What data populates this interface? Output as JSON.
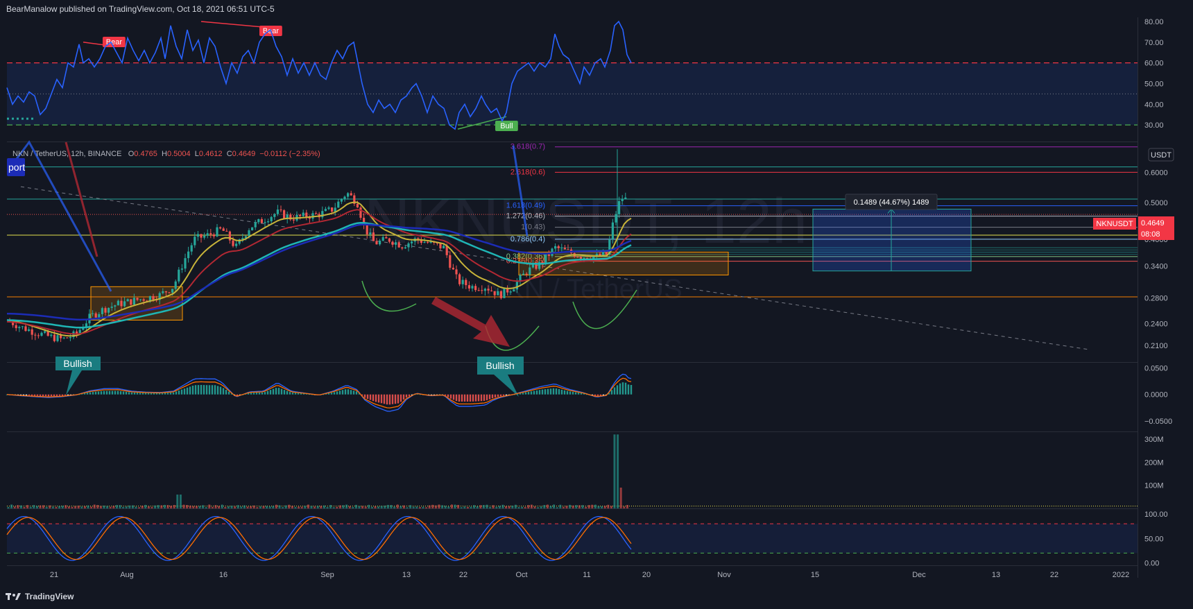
{
  "header": {
    "author": "BearManalow",
    "text": "BearManalow published on TradingView.com, Oct 18, 2021 06:51 UTC-5"
  },
  "footer": {
    "brand": "TradingView"
  },
  "symbol_line": {
    "name": "NKN / TetherUS, 12h, BINANCE",
    "open_label": "O",
    "open": "0.4765",
    "high_label": "H",
    "high": "0.5004",
    "low_label": "L",
    "low": "0.4612",
    "close_label": "C",
    "close": "0.4649",
    "change": "−0.0112 (−2.35%)"
  },
  "watermark": {
    "main": "NKNUSDT, 12h",
    "sub": "NKN / TetherUS"
  },
  "currency_badge": "USDT",
  "price_tag": {
    "symbol": "NKNUSDT",
    "price": "0.4649",
    "countdown": "08:08"
  },
  "measure_label": "0.1489 (44.67%) 1489",
  "labels": {
    "bear1": "Bear",
    "bear2": "Bear",
    "bull": "Bull",
    "bullish1": "Bullish",
    "bullish2": "Bullish",
    "support": "port"
  },
  "colors": {
    "background": "#131722",
    "rsi_line": "#2962ff",
    "bull": "#26a69a",
    "bear": "#ef5350",
    "ema_yellow": "#c8b43a",
    "ema_red": "#b22833",
    "ema_teal": "#1fb5b5",
    "ema_blue": "#1c2cb7"
  },
  "chart_data": {
    "type": "candlestick-multi-panel",
    "x_ticks": [
      "21",
      "Aug",
      "16",
      "Sep",
      "13",
      "22",
      "Oct",
      "11",
      "20",
      "Nov",
      "15",
      "Dec",
      "13",
      "22",
      "2022"
    ],
    "price_panel": {
      "ylim": [
        0.19,
        0.72
      ],
      "y_ticks": [
        "0.2100",
        "0.2400",
        "0.2800",
        "0.3400",
        "0.4000",
        "0.5000",
        "0.6000"
      ],
      "fib_levels": [
        {
          "label": "3.618(0.7)",
          "value": 0.7,
          "color": "#9c27b0"
        },
        {
          "label": "2.618(0.6)",
          "value": 0.6,
          "color": "#f23645"
        },
        {
          "label": "1.618(0.49)",
          "value": 0.49,
          "color": "#2962ff"
        },
        {
          "label": "1.272(0.46)",
          "value": 0.46,
          "color": "#b2b5be"
        },
        {
          "label": "1(0.43)",
          "value": 0.43,
          "color": "#787b86"
        },
        {
          "label": "0.786(0.4)",
          "value": 0.4,
          "color": "#90caf9"
        },
        {
          "label": "0.382(0.36)",
          "value": 0.36,
          "color": "#81c784"
        },
        {
          "label": "0.236(0.35)",
          "value": 0.35,
          "color": "#ef5350"
        }
      ],
      "last_price": 0.4649
    },
    "rsi_panel": {
      "ylim": [
        22,
        82
      ],
      "y_ticks": [
        "30.00",
        "40.00",
        "50.00",
        "60.00",
        "70.00",
        "80.00"
      ],
      "overbought": 60,
      "oversold": 30
    },
    "macd_panel": {
      "ylim": [
        -0.07,
        0.06
      ],
      "y_ticks": [
        "0.0500",
        "0.0000",
        "−0.0500"
      ]
    },
    "volume_panel": {
      "ylim": [
        0,
        330
      ],
      "y_ticks": [
        "100M",
        "200M",
        "300M"
      ]
    },
    "stoch_panel": {
      "ylim": [
        -5,
        110
      ],
      "y_ticks": [
        "0.00",
        "50.00",
        "100.00"
      ]
    }
  }
}
